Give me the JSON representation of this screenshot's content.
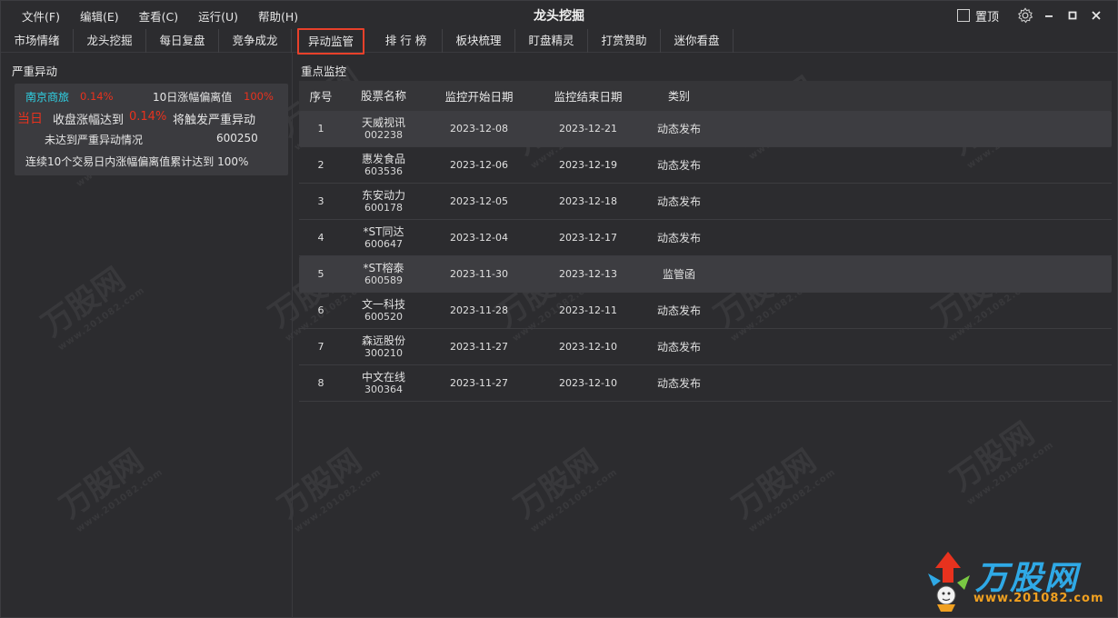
{
  "menu": [
    {
      "label": "文件(F)"
    },
    {
      "label": "编辑(E)"
    },
    {
      "label": "查看(C)"
    },
    {
      "label": "运行(U)"
    },
    {
      "label": "帮助(H)"
    }
  ],
  "app_title": "龙头挖掘",
  "pin_label": "置顶",
  "tabs": [
    {
      "label": "市场情绪",
      "active": false
    },
    {
      "label": "龙头挖掘",
      "active": false
    },
    {
      "label": "每日复盘",
      "active": false
    },
    {
      "label": "竞争成龙",
      "active": false
    },
    {
      "label": "异动监管",
      "active": true
    },
    {
      "label": "排 行 榜",
      "active": false
    },
    {
      "label": "板块梳理",
      "active": false
    },
    {
      "label": "盯盘精灵",
      "active": false
    },
    {
      "label": "打赏赞助",
      "active": false
    },
    {
      "label": "迷你看盘",
      "active": false
    }
  ],
  "left_panel": {
    "title": "严重异动",
    "stock_name": "南京商旅",
    "stock_pct": "0.14%",
    "metric_label": "10日涨幅偏离值",
    "metric_value": "100%",
    "day_label": "当日",
    "rise_label": "收盘涨幅达到",
    "rise_value": "0.14%",
    "trigger_label": "将触发严重异动",
    "not_reached": "未达到严重异动情况",
    "code": "600250",
    "rule": "连续10个交易日内涨幅偏离值累计达到 100%"
  },
  "right_panel": {
    "title": "重点监控",
    "headers": [
      "序号",
      "股票名称",
      "监控开始日期",
      "监控结束日期",
      "类别"
    ],
    "rows": [
      {
        "idx": "1",
        "name": "天威视讯",
        "code": "002238",
        "start": "2023-12-08",
        "end": "2023-12-21",
        "type": "动态发布"
      },
      {
        "idx": "2",
        "name": "惠发食品",
        "code": "603536",
        "start": "2023-12-06",
        "end": "2023-12-19",
        "type": "动态发布"
      },
      {
        "idx": "3",
        "name": "东安动力",
        "code": "600178",
        "start": "2023-12-05",
        "end": "2023-12-18",
        "type": "动态发布"
      },
      {
        "idx": "4",
        "name": "*ST同达",
        "code": "600647",
        "start": "2023-12-04",
        "end": "2023-12-17",
        "type": "动态发布"
      },
      {
        "idx": "5",
        "name": "*ST榕泰",
        "code": "600589",
        "start": "2023-11-30",
        "end": "2023-12-13",
        "type": "监管函"
      },
      {
        "idx": "6",
        "name": "文一科技",
        "code": "600520",
        "start": "2023-11-28",
        "end": "2023-12-11",
        "type": "动态发布"
      },
      {
        "idx": "7",
        "name": "森远股份",
        "code": "300210",
        "start": "2023-11-27",
        "end": "2023-12-10",
        "type": "动态发布"
      },
      {
        "idx": "8",
        "name": "中文在线",
        "code": "300364",
        "start": "2023-11-27",
        "end": "2023-12-10",
        "type": "动态发布"
      }
    ]
  },
  "watermark": {
    "text": "万股网",
    "url": "www.201082.com"
  },
  "brand": {
    "text": "万股网",
    "url": "www.201082.com"
  },
  "colors": {
    "accent_red": "#e8321e",
    "accent_cyan": "#2fd3e6",
    "tab_highlight": "#e8402a",
    "brand_blue": "#2fa9e6",
    "brand_orange": "#f0a020"
  },
  "icons": [
    "gear-icon",
    "minimize-icon",
    "maximize-icon",
    "close-icon",
    "checkbox-icon"
  ]
}
